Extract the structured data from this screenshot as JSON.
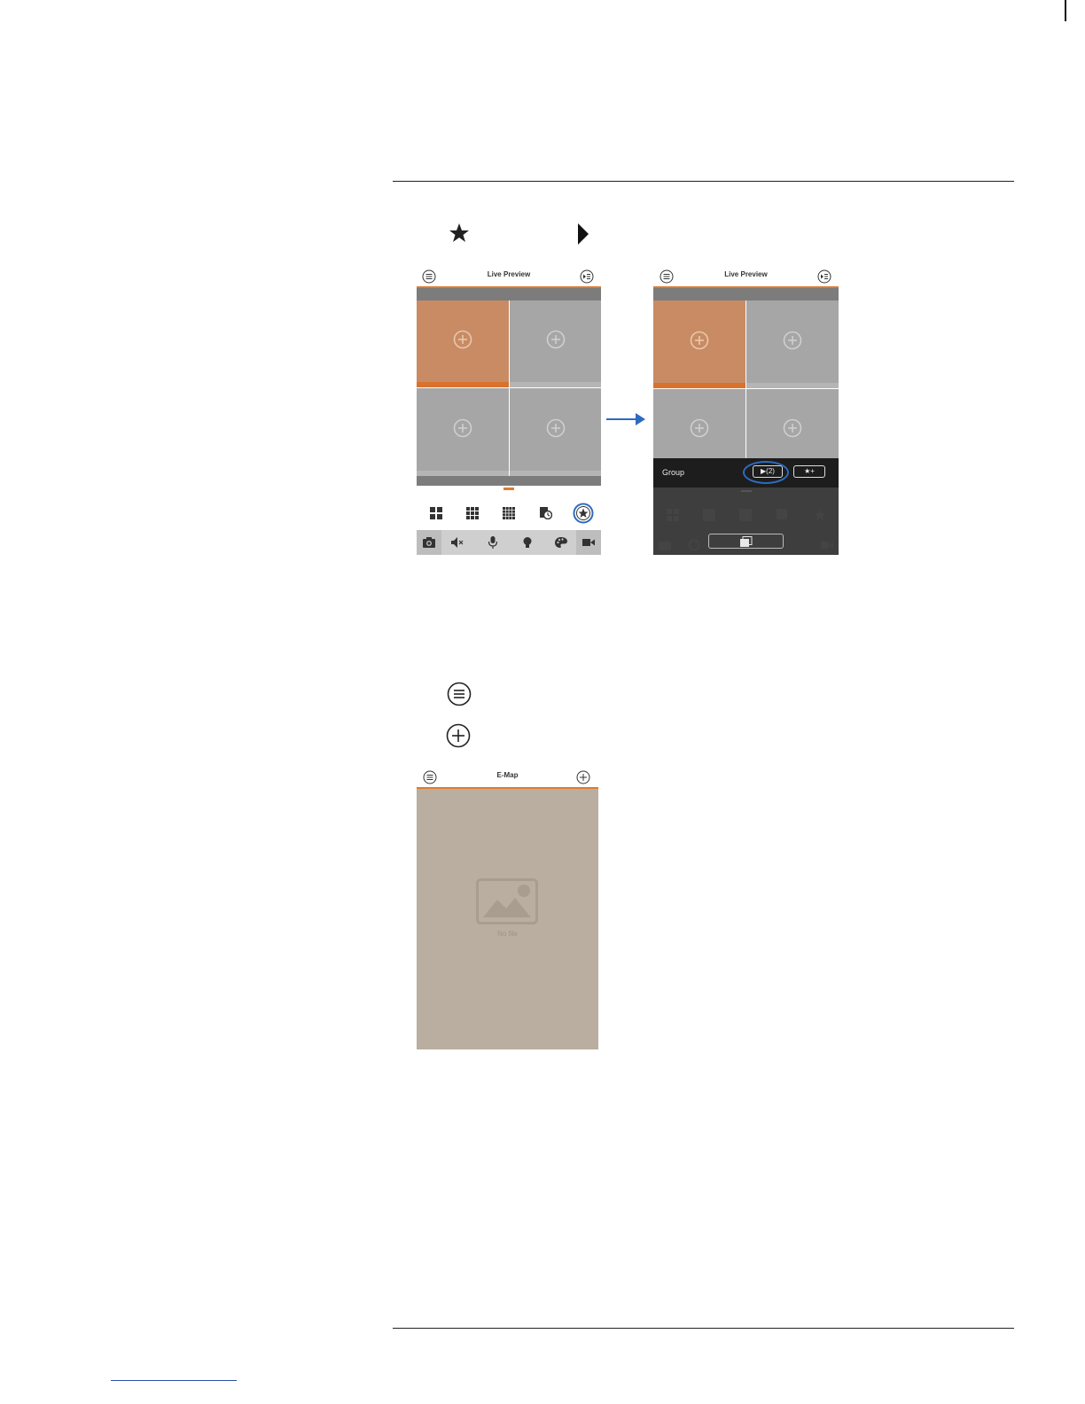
{
  "screen_left": {
    "title": "Live Preview"
  },
  "screen_right": {
    "title": "Live Preview",
    "group_label": "Group",
    "play_button_label": "▶(2)",
    "add_fav_label": "★+"
  },
  "screen_emap": {
    "title": "E-Map",
    "empty_text": "No file"
  },
  "icons": {
    "step_star": "star-icon",
    "step_play": "play-triangle-icon",
    "step_menu": "menu-icon",
    "step_add": "add-circle-icon",
    "arrow": "arrow-right-icon"
  },
  "colors": {
    "accent": "#e07a2e",
    "selected_tile": "#c98b63",
    "tile": "#a6a6a6",
    "callout": "#2e6bbf",
    "emap_bg": "#b9ae9f"
  }
}
